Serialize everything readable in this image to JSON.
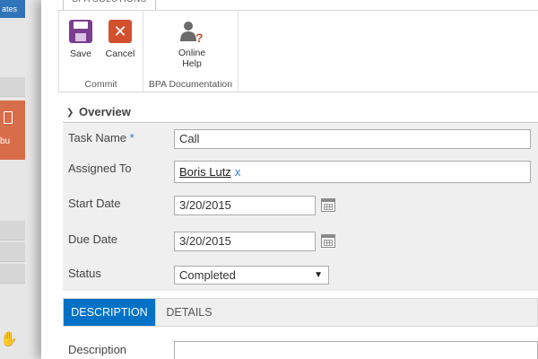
{
  "ribbon": {
    "tab_label": "BPA SOLUTIONS",
    "groups": [
      {
        "label": "Commit",
        "buttons": [
          {
            "label": "Save",
            "icon": "save-icon"
          },
          {
            "label": "Cancel",
            "icon": "cancel-icon"
          }
        ]
      },
      {
        "label": "BPA Documentation",
        "buttons": [
          {
            "label_line1": "Online",
            "label_line2": "Help",
            "icon": "online-help-icon"
          }
        ]
      }
    ]
  },
  "overview": {
    "title": "Overview",
    "fields": {
      "task_name": {
        "label": "Task Name",
        "required_marker": "*",
        "value": "Call"
      },
      "assigned_to": {
        "label": "Assigned To",
        "person": "Boris Lutz",
        "remove": "x"
      },
      "start_date": {
        "label": "Start Date",
        "value": "3/20/2015"
      },
      "due_date": {
        "label": "Due Date",
        "value": "3/20/2015"
      },
      "status": {
        "label": "Status",
        "value": "Completed",
        "caret": "▼"
      }
    }
  },
  "tabs": [
    {
      "label": "DESCRIPTION",
      "active": true
    },
    {
      "label": "DETAILS",
      "active": false
    }
  ],
  "description": {
    "label": "Description",
    "value": ""
  },
  "background": {
    "left_strip_text": "ates",
    "orange_tile_text": "bu"
  },
  "colors": {
    "accent": "#0072c6",
    "required": "#2e7bcf",
    "save_icon": "#7a3d8f",
    "cancel_icon": "#d3502f",
    "tile": "#d86d4a"
  }
}
